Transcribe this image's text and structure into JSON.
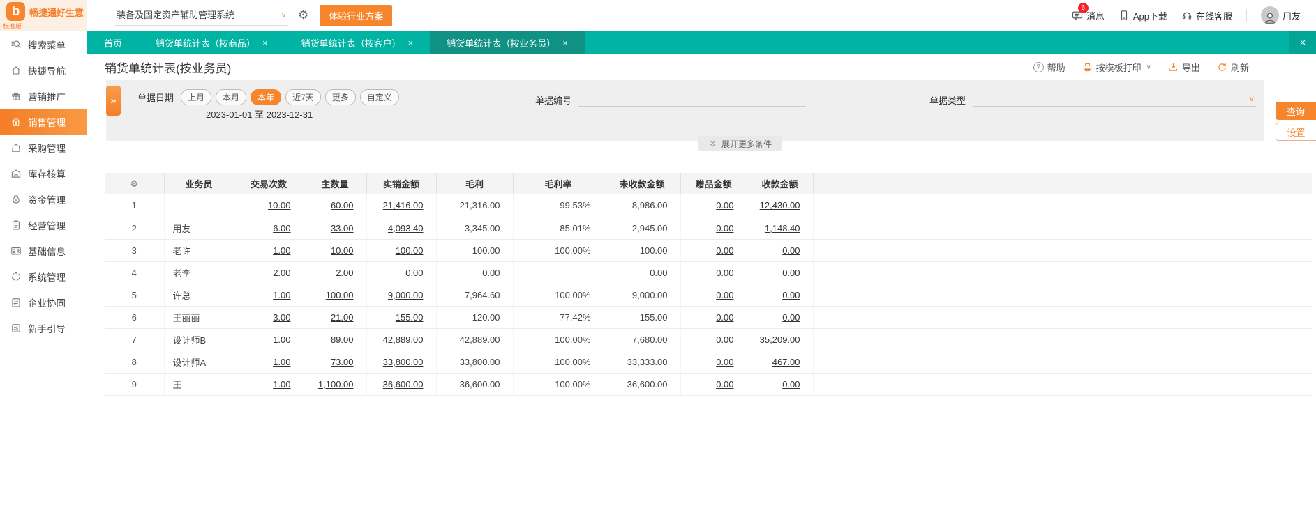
{
  "colors": {
    "accent": "#f6852c",
    "tabbar": "#01b3a2",
    "active_tab": "#0f9184",
    "badge": "#f5222d"
  },
  "topbar": {
    "logo_title": "畅捷通好生意",
    "logo_badge": "标准版",
    "logo_glyph": "b",
    "system_select": "装备及固定资产辅助管理系统",
    "trial_button": "体验行业方案",
    "messages": "消息",
    "messages_badge": "6",
    "app_download": "App下载",
    "online_service": "在线客服",
    "username": "用友"
  },
  "sidebar": {
    "items": [
      {
        "id": "search-menu",
        "label": "搜索菜单",
        "icon": "search-icon",
        "active": false
      },
      {
        "id": "quick-nav",
        "label": "快捷导航",
        "icon": "home-icon",
        "active": false
      },
      {
        "id": "marketing",
        "label": "营销推广",
        "icon": "gift-icon",
        "active": false
      },
      {
        "id": "sales-mgmt",
        "label": "销售管理",
        "icon": "sales-icon",
        "active": true
      },
      {
        "id": "purchase-mgmt",
        "label": "采购管理",
        "icon": "purchase-icon",
        "active": false
      },
      {
        "id": "inventory-accounting",
        "label": "库存核算",
        "icon": "inventory-icon",
        "active": false
      },
      {
        "id": "funds-mgmt",
        "label": "资金管理",
        "icon": "funds-icon",
        "active": false
      },
      {
        "id": "operations-mgmt",
        "label": "经营管理",
        "icon": "operations-icon",
        "active": false
      },
      {
        "id": "basic-info",
        "label": "基础信息",
        "icon": "basic-info-icon",
        "active": false
      },
      {
        "id": "system-mgmt",
        "label": "系统管理",
        "icon": "system-icon",
        "active": false
      },
      {
        "id": "enterprise-collab",
        "label": "企业协同",
        "icon": "collab-icon",
        "active": false
      },
      {
        "id": "beginner-guide",
        "label": "新手引导",
        "icon": "guide-icon",
        "active": false
      }
    ]
  },
  "tabs": [
    {
      "label": "首页",
      "closable": false,
      "active": false
    },
    {
      "label": "销货单统计表（按商品）",
      "closable": true,
      "active": false
    },
    {
      "label": "销货单统计表（按客户）",
      "closable": true,
      "active": false
    },
    {
      "label": "销货单统计表（按业务员）",
      "closable": true,
      "active": true
    }
  ],
  "page": {
    "title": "销货单统计表(按业务员)",
    "toolbar": {
      "help": "帮助",
      "print": "按模板打印",
      "export": "导出",
      "refresh": "刷新"
    }
  },
  "filters": {
    "date_label": "单据日期",
    "date_pills": [
      "上月",
      "本月",
      "本年",
      "近7天",
      "更多",
      "自定义"
    ],
    "active_pill": "本年",
    "date_range": "2023-01-01 至 2023-12-31",
    "bill_no_label": "单据编号",
    "bill_no_value": "",
    "bill_type_label": "单据类型",
    "bill_type_value": "",
    "query_button": "查询",
    "settings_button": "设置",
    "expand_more": "展开更多条件"
  },
  "table": {
    "columns": [
      "业务员",
      "交易次数",
      "主数量",
      "实销金额",
      "毛利",
      "毛利率",
      "未收款金额",
      "赠品金额",
      "收款金额"
    ],
    "link_columns": [
      "交易次数",
      "主数量",
      "实销金额",
      "赠品金额",
      "收款金额"
    ],
    "rows": [
      {
        "no": "1",
        "name": "",
        "values": [
          "10.00",
          "60.00",
          "21,416.00",
          "21,316.00",
          "99.53%",
          "8,986.00",
          "0.00",
          "12,430.00"
        ]
      },
      {
        "no": "2",
        "name": "用友",
        "values": [
          "6.00",
          "33.00",
          "4,093.40",
          "3,345.00",
          "85.01%",
          "2,945.00",
          "0.00",
          "1,148.40"
        ]
      },
      {
        "no": "3",
        "name": "老许",
        "values": [
          "1.00",
          "10.00",
          "100.00",
          "100.00",
          "100.00%",
          "100.00",
          "0.00",
          "0.00"
        ]
      },
      {
        "no": "4",
        "name": "老李",
        "values": [
          "2.00",
          "2.00",
          "0.00",
          "0.00",
          "",
          "0.00",
          "0.00",
          "0.00"
        ]
      },
      {
        "no": "5",
        "name": "许总",
        "values": [
          "1.00",
          "100.00",
          "9,000.00",
          "7,964.60",
          "100.00%",
          "9,000.00",
          "0.00",
          "0.00"
        ]
      },
      {
        "no": "6",
        "name": "王丽丽",
        "values": [
          "3.00",
          "21.00",
          "155.00",
          "120.00",
          "77.42%",
          "155.00",
          "0.00",
          "0.00"
        ]
      },
      {
        "no": "7",
        "name": "设计师B",
        "values": [
          "1.00",
          "89.00",
          "42,889.00",
          "42,889.00",
          "100.00%",
          "7,680.00",
          "0.00",
          "35,209.00"
        ]
      },
      {
        "no": "8",
        "name": "设计师A",
        "values": [
          "1.00",
          "73.00",
          "33,800.00",
          "33,800.00",
          "100.00%",
          "33,333.00",
          "0.00",
          "467.00"
        ]
      },
      {
        "no": "9",
        "name": "王",
        "values": [
          "1.00",
          "1,100.00",
          "36,600.00",
          "36,600.00",
          "100.00%",
          "36,600.00",
          "0.00",
          "0.00"
        ]
      }
    ]
  }
}
